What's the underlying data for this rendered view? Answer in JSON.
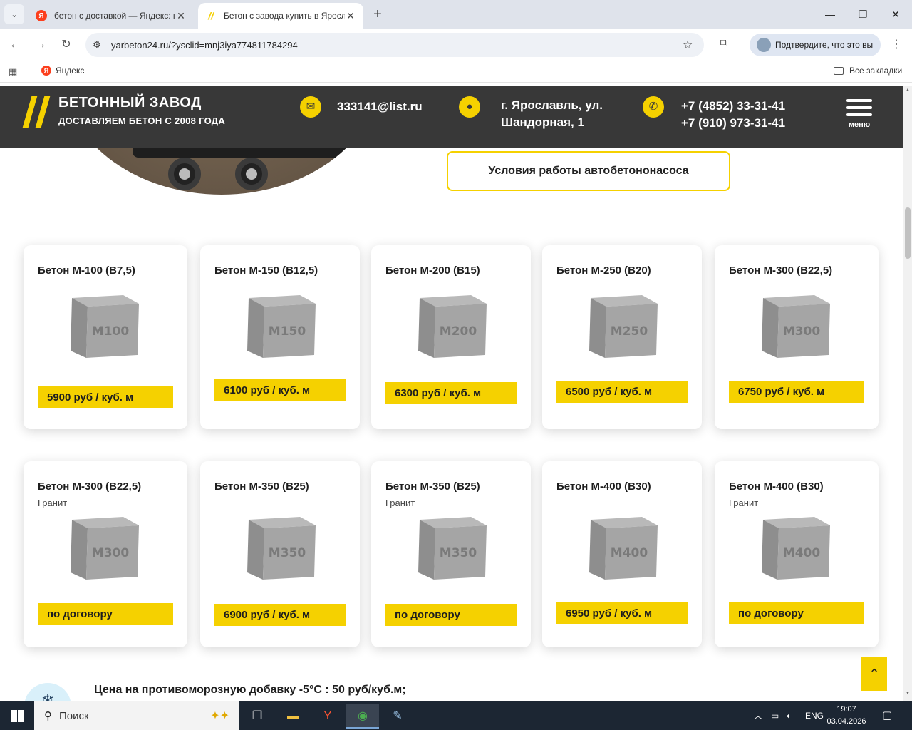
{
  "browser": {
    "tabs": [
      {
        "title": "бетон с доставкой — Яндекс: нашлось",
        "favicon": "Я"
      },
      {
        "title": "Бетон с завода купить в Ярославле",
        "favicon": "//"
      }
    ],
    "url": "yarbeton24.ru/?ysclid=mnj3iya774811784294",
    "profile_label": "Подтвердите, что это вы",
    "bookmarks": {
      "yandex": "Яндекс",
      "all": "Все закладки"
    }
  },
  "header": {
    "brand_title": "БЕТОННЫЙ ЗАВОД",
    "brand_subtitle": "ДОСТАВЛЯЕМ БЕТОН С 2008 ГОДА",
    "email": "333141@list.ru",
    "address_line1": "г. Ярославль, ул.",
    "address_line2": "Шандорная, 1",
    "phone1": "+7 (4852) 33-31-41",
    "phone2": "+7 (910) 973-31-41",
    "menu_label": "меню",
    "icons": {
      "email": "envelope-icon",
      "address": "map-pin-icon",
      "phone": "phone-icon",
      "menu": "hamburger-icon"
    }
  },
  "pump_button": "Условия работы автобетононасоса",
  "products": [
    {
      "name": "Бетон М-100 (B7,5)",
      "sub": "",
      "cube": "M100",
      "price": "5900 руб / куб. м"
    },
    {
      "name": "Бетон М-150 (B12,5)",
      "sub": "",
      "cube": "M150",
      "price": "6100 руб / куб. м"
    },
    {
      "name": "Бетон М-200 (B15)",
      "sub": "",
      "cube": "M200",
      "price": "6300 руб / куб. м"
    },
    {
      "name": "Бетон М-250 (B20)",
      "sub": "",
      "cube": "M250",
      "price": "6500 руб / куб. м"
    },
    {
      "name": "Бетон М-300 (B22,5)",
      "sub": "",
      "cube": "M300",
      "price": "6750 руб / куб. м"
    },
    {
      "name": "Бетон М-300 (B22,5)",
      "sub": "Гранит",
      "cube": "M300",
      "price": "по договору"
    },
    {
      "name": "Бетон М-350 (B25)",
      "sub": "",
      "cube": "M350",
      "price": "6900 руб / куб. м"
    },
    {
      "name": "Бетон М-350 (B25)",
      "sub": "Гранит",
      "cube": "M350",
      "price": "по договору"
    },
    {
      "name": "Бетон М-400 (B30)",
      "sub": "",
      "cube": "M400",
      "price": "6950 руб / куб. м"
    },
    {
      "name": "Бетон М-400 (B30)",
      "sub": "Гранит",
      "cube": "M400",
      "price": "по договору"
    }
  ],
  "frost_note": "Цена на противоморозную добавку -5°С : 50 руб/куб.м;",
  "taskbar": {
    "search_placeholder": "Поиск",
    "lang": "ENG",
    "time": "19:07",
    "date": "03.04.2026"
  },
  "colors": {
    "accent": "#f5d100",
    "header_bg": "#383838",
    "taskbar_bg": "#1c2633"
  }
}
